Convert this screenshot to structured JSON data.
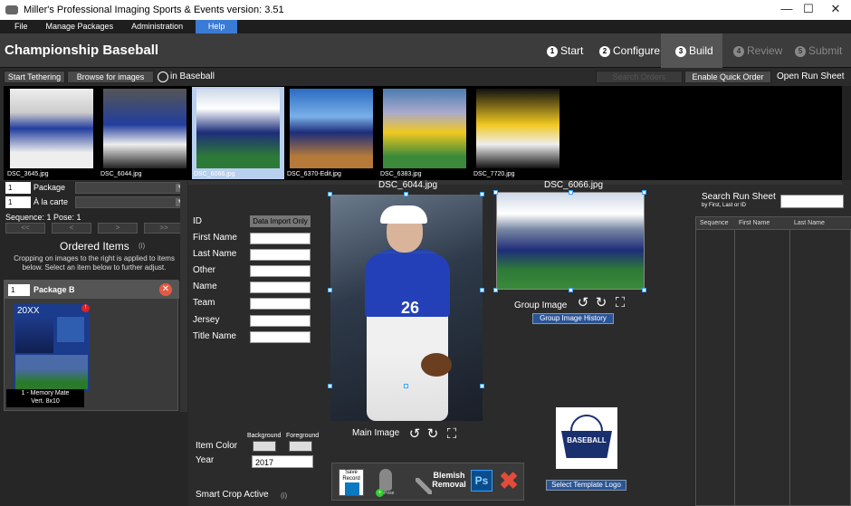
{
  "window": {
    "title": "Miller's Professional Imaging Sports & Events version: 3.51",
    "minimize": "—",
    "maximize": "☐",
    "close": "✕"
  },
  "menu": [
    "File",
    "Manage Packages",
    "Administration",
    "Help"
  ],
  "header": {
    "title": "Championship Baseball",
    "steps": [
      {
        "num": "1",
        "label": "Start"
      },
      {
        "num": "2",
        "label": "Configure"
      },
      {
        "num": "3",
        "label": "Build"
      },
      {
        "num": "4",
        "label": "Review"
      },
      {
        "num": "5",
        "label": "Submit"
      }
    ]
  },
  "toolbar": {
    "start_tethering": "Start Tethering",
    "browse_images": "Browse for images",
    "in_label": "in Baseball",
    "search_orders": "Search Orders",
    "enable_quick_order": "Enable Quick Order",
    "open_run_sheet": "Open Run Sheet"
  },
  "thumbnails": [
    {
      "file": "DSC_3645.jpg",
      "selected": false
    },
    {
      "file": "DSC_6044.jpg",
      "selected": false
    },
    {
      "file": "DSC_6066.jpg",
      "selected": true
    },
    {
      "file": "DSC_6370-Edit.jpg",
      "selected": false
    },
    {
      "file": "DSC_6383.jpg",
      "selected": false
    },
    {
      "file": "DSC_7720.jpg",
      "selected": false
    }
  ],
  "order": {
    "package_qty": "1",
    "package_label": "Package",
    "alacarte_qty": "1",
    "alacarte_label": "À la carte",
    "sequence": "Sequence: 1  Pose: 1",
    "nav": [
      "<<",
      "<",
      ">",
      ">>"
    ],
    "ordered_title": "Ordered Items",
    "info_icon": "(i)",
    "crop_note": "Cropping on images to the right is applied to items below. Select an item below to further adjust."
  },
  "package": {
    "qty": "1",
    "name": "Package B",
    "close": "✕",
    "card_year": "20XX",
    "badge": "!",
    "caption_line1": "1 - Memory Mate",
    "caption_line2": "Vert. 8x10"
  },
  "form": {
    "id_label": "ID",
    "id_value": "Data Import Only",
    "fields": [
      "First Name",
      "Last Name",
      "Other",
      "Name",
      "Team",
      "Jersey",
      "Title Name"
    ],
    "item_color": "Item Color",
    "background": "Background",
    "foreground": "Foreground",
    "year_label": "Year",
    "year_value": "2017",
    "smart_crop": "Smart Crop Active",
    "smart_info": "(i)"
  },
  "main_image": {
    "file": "DSC_6044.jpg",
    "label": "Main Image",
    "jersey_number": "26"
  },
  "group_image": {
    "file": "DSC_6066.jpg",
    "label": "Group Image",
    "history": "Group Image History"
  },
  "logo": {
    "text": "BASEBALL",
    "select": "Select Template Logo"
  },
  "bottom": {
    "save_record": "Save Record",
    "pose": "Pose",
    "blemish": "Blemish Removal",
    "ps": "Ps",
    "delete": "✖"
  },
  "runsheet": {
    "title": "Search Run Sheet",
    "subtitle": "by First, Last or ID",
    "columns": [
      "Sequence",
      "First Name",
      "Last Name"
    ]
  },
  "colors": {
    "accent_blue": "#2a5496",
    "menu_help": "#3a7bd5",
    "selected_thumb": "#b8cfee",
    "close_red": "#e35b45"
  }
}
